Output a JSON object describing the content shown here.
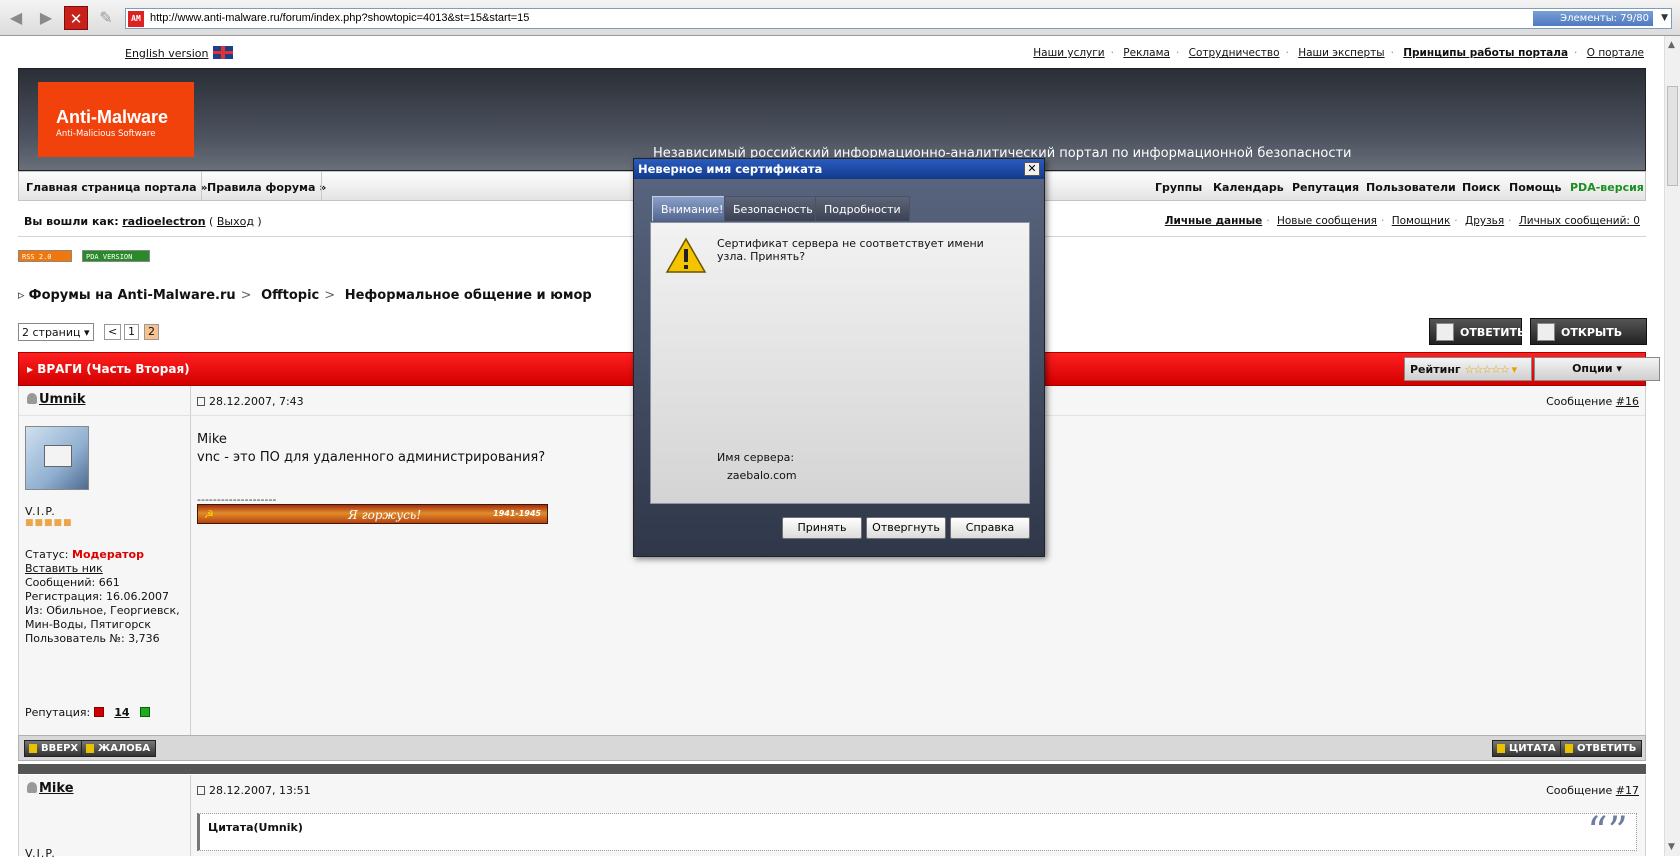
{
  "browser": {
    "url": "http://www.anti-malware.ru/forum/index.php?showtopic=4013&st=15&start=15",
    "elements_counter": "Элементы:  79/80",
    "favicon_text": "AM"
  },
  "header": {
    "english_link": "English version",
    "top_links": [
      "Наши услуги",
      "Реклама",
      "Сотрудничество",
      "Наши эксперты",
      "Принципы работы портала",
      "О портале"
    ],
    "logo_title": "Anti-Malware",
    "logo_subtitle": "Anti-Malicious Software",
    "slogan": "Независимый российский информационно-аналитический портал по информационной безопасности"
  },
  "nav": {
    "left": [
      "Главная страница портала »",
      "Правила форума »"
    ],
    "right": [
      "Группы",
      "Календарь",
      "Репутация",
      "Пользователи",
      "Поиск",
      "Помощь",
      "PDA-версия"
    ]
  },
  "userbar": {
    "logged_as": "Вы вошли как:",
    "username": "radioelectron",
    "logout": "Выход",
    "links": [
      "Личные данные",
      "Новые сообщения",
      "Помощник",
      "Друзья",
      "Личных сообщений: 0"
    ]
  },
  "badges": {
    "rss": "RSS  2.0",
    "pda": "PDA  VERSION"
  },
  "breadcrumb": [
    "Форумы на Anti-Malware.ru",
    "Offtopic",
    "Неформальное общение и юмор"
  ],
  "pager": {
    "pages_select": "2 страниц ▾",
    "prev": "<",
    "p1": "1",
    "p2": "2"
  },
  "actions": {
    "reply": "ОТВЕТИТЬ",
    "new_topic": "ОТКРЫТЬ ТЕМУ"
  },
  "topic": {
    "title": "ВРАГИ (Часть Вторая)",
    "rating_label": "Рейтинг",
    "rating_stars": "☆☆☆☆☆ ▾",
    "options": "Опции ▾"
  },
  "post16": {
    "author": "Umnik",
    "date": "28.12.2007, 7:43",
    "number_label": "Сообщение",
    "number": "#16",
    "title": "V.I.P.",
    "pips": "■■■■■",
    "status_label": "Статус:",
    "status": "Модератор",
    "insert_nick": "Вставить ник",
    "posts": "Сообщений: 661",
    "reg": "Регистрация: 16.06.2007",
    "from": "Из: Обильное, Георгиевск, Мин-Воды, Пятигорск",
    "user_no": "Пользователь №: 3,736",
    "rep_label": "Репутация:",
    "rep_value": "14",
    "body_line1": "Mike",
    "body_line2": "vnc - это ПО для удаленного администрирования?",
    "sig_sep": "--------------------",
    "sig_years": "1941-1945",
    "sig_text": "Я горжусь!",
    "btn_up": "ВВЕРХ",
    "btn_complain": "ЖАЛОБА",
    "btn_quote": "ЦИТАТА",
    "btn_reply": "ОТВЕТИТЬ"
  },
  "post17": {
    "author": "Mike",
    "date": "28.12.2007, 13:51",
    "number_label": "Сообщение",
    "number": "#17",
    "title": "V.I.P.",
    "quote_head": "Цитата(Umnik)"
  },
  "dialog": {
    "title": "Неверное имя сертификата",
    "close": "✕",
    "tabs": [
      "Внимание!",
      "Безопасность",
      "Подробности"
    ],
    "message": "Сертификат сервера не соответствует имени узла. Принять?",
    "server_label": "Имя сервера:",
    "server_value": "zaebalo.com",
    "accept": "Принять",
    "reject": "Отвергнуть",
    "help": "Справка"
  }
}
